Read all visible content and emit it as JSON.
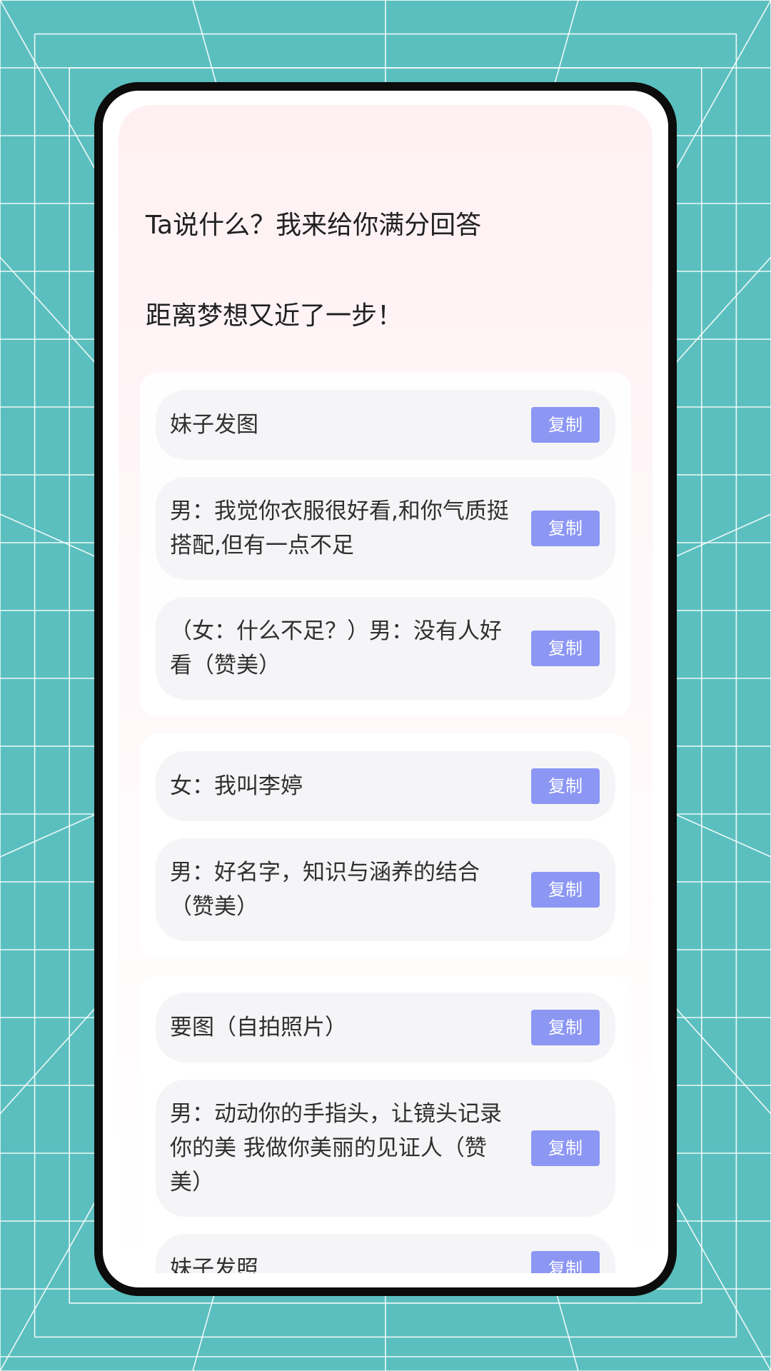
{
  "headline": "Ta说什么？我来给你满分回答",
  "subheadline": "距离梦想又近了一步！",
  "copy_label": "复制",
  "colors": {
    "background": "#5bbfbf",
    "grid_lines": "#ffffff",
    "phone_frame": "#0c0c0c",
    "screen_top": "#fff0f3",
    "card_bg": "#f5f5f7",
    "copy_button": "#8c96f3"
  },
  "groups": [
    {
      "items": [
        {
          "text": "妹子发图"
        },
        {
          "text": "男：我觉你衣服很好看,和你气质挺搭配,但有一点不足"
        },
        {
          "text": "（女：什么不足？）男：没有人好看（赞美）"
        }
      ]
    },
    {
      "items": [
        {
          "text": "女：我叫李婷"
        },
        {
          "text": "男：好名字，知识与涵养的结合（赞美）"
        }
      ]
    },
    {
      "items": [
        {
          "text": "要图（自拍照片）"
        },
        {
          "text": "男：动动你的手指头，让镜头记录你的美 我做你美丽的见证人（赞美）"
        },
        {
          "text": "妹子发照"
        }
      ]
    }
  ]
}
